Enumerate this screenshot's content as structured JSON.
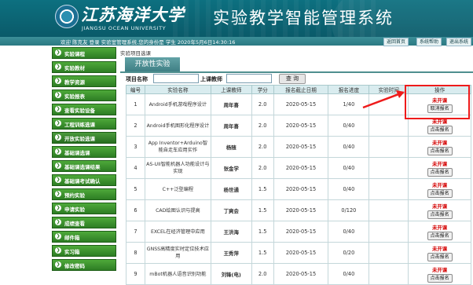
{
  "header": {
    "univ_cn": "江苏海洋大学",
    "univ_en": "JIANGSU OCEAN UNIVERSITY",
    "system_title": "实验教学智能管理系统"
  },
  "topbar": {
    "welcome": "欢迎 陈克友 登录  实验室管理系统,您的身份是 学生  2020年5月6日14:30:16",
    "buttons": [
      "返回首页",
      "系统帮助",
      "退出系统"
    ]
  },
  "sidebar": {
    "items": [
      "实验课程",
      "实验教材",
      "教学资源",
      "实验报表",
      "查看实验设备",
      "工程训练选课",
      "开放实验选课",
      "基础课选课",
      "基础课选课结果",
      "基础课考试确认",
      "预约实验",
      "申请实验",
      "成绩查看",
      "邮件箱",
      "实习箱",
      "修改密码"
    ]
  },
  "breadcrumb": "实验项目选课",
  "tab": "开放性实验",
  "search": {
    "name_label": "项目名称",
    "teacher_label": "上课教师",
    "button": "查 询"
  },
  "table": {
    "headers": [
      "编号",
      "实验名称",
      "上课教师",
      "学分",
      "报名截止日期",
      "报名进度",
      "实验时间",
      "操作"
    ],
    "rows": [
      {
        "no": "1",
        "name": "Android手机游戏程序设计",
        "teacher": "周年喜",
        "credit": "2.0",
        "deadline": "2020-05-15",
        "progress": "1/40",
        "time": "",
        "status": "未开课",
        "action": "取消报名"
      },
      {
        "no": "2",
        "name": "Android手机图形化程序设计",
        "teacher": "周年喜",
        "credit": "2.0",
        "deadline": "2020-05-15",
        "progress": "0/40",
        "time": "",
        "status": "未开课",
        "action": "点击报名"
      },
      {
        "no": "3",
        "name": "App Inventor+Arduino智能自走车应用实作",
        "teacher": "杨随",
        "credit": "2.0",
        "deadline": "2020-05-15",
        "progress": "0/40",
        "time": "",
        "status": "未开课",
        "action": "点击报名"
      },
      {
        "no": "4",
        "name": "AS-UII智能机器人功能设计与实现",
        "teacher": "张金学",
        "credit": "2.0",
        "deadline": "2020-05-15",
        "progress": "0/40",
        "time": "",
        "status": "未开课",
        "action": "点击报名"
      },
      {
        "no": "5",
        "name": "C++泛型编程",
        "teacher": "杨世通",
        "credit": "1.5",
        "deadline": "2020-05-15",
        "progress": "0/40",
        "time": "",
        "status": "未开课",
        "action": "点击报名"
      },
      {
        "no": "6",
        "name": "CAD绘图认识与提高",
        "teacher": "丁爽会",
        "credit": "1.5",
        "deadline": "2020-05-15",
        "progress": "0/120",
        "time": "",
        "status": "未开课",
        "action": "点击报名"
      },
      {
        "no": "7",
        "name": "EXCEL在经济管理中应用",
        "teacher": "王洪海",
        "credit": "1.5",
        "deadline": "2020-05-15",
        "progress": "0/40",
        "time": "",
        "status": "未开课",
        "action": "点击报名"
      },
      {
        "no": "8",
        "name": "GNSS高精度实时定位技术应用",
        "teacher": "王秀萍",
        "credit": "1.5",
        "deadline": "2020-05-15",
        "progress": "0/20",
        "time": "",
        "status": "未开课",
        "action": "点击报名"
      },
      {
        "no": "9",
        "name": "mBot机器人语音识别功能",
        "teacher": "刘锋(电)",
        "credit": "2.0",
        "deadline": "2020-05-15",
        "progress": "0/40",
        "time": "",
        "status": "未开课",
        "action": "点击报名"
      }
    ]
  },
  "colors": {
    "banner": "#0d7080",
    "sidebar_green": "#2d7d24",
    "status_red": "#d40000",
    "highlight": "#ee1b1b"
  }
}
